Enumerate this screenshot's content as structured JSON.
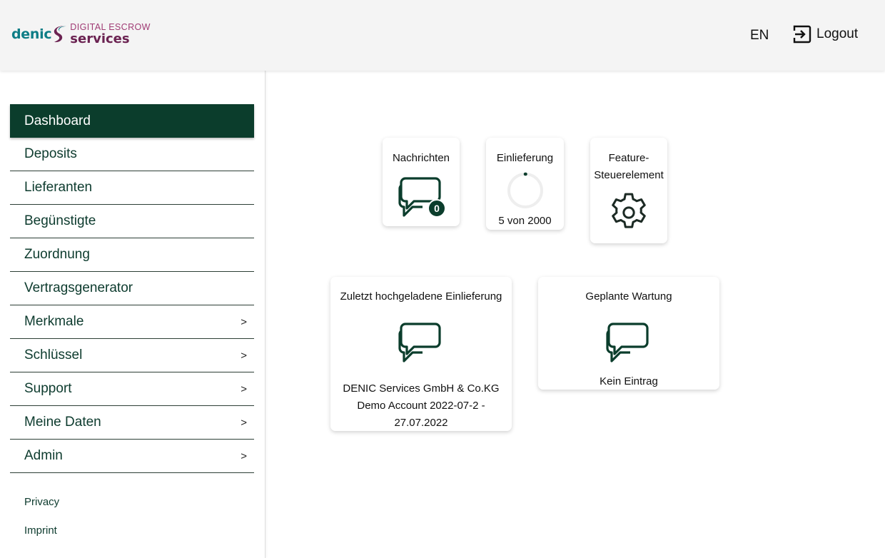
{
  "header": {
    "logo": {
      "brand": "denic",
      "top_line": "DIGITAL ESCROW",
      "bottom_line": "services"
    },
    "language": "EN",
    "logout_label": "Logout"
  },
  "sidebar": {
    "items": [
      {
        "label": "Dashboard",
        "active": true,
        "arrow": ""
      },
      {
        "label": "Deposits",
        "arrow": ""
      },
      {
        "label": "Lieferanten",
        "arrow": ""
      },
      {
        "label": "Begünstigte",
        "arrow": ""
      },
      {
        "label": "Zuordnung",
        "arrow": ""
      },
      {
        "label": "Vertragsgenerator",
        "arrow": ""
      },
      {
        "label": "Merkmale",
        "arrow": ">"
      },
      {
        "label": "Schlüssel",
        "arrow": ">"
      },
      {
        "label": "Support",
        "arrow": ">"
      },
      {
        "label": "Meine Daten",
        "arrow": ">"
      },
      {
        "label": "Admin",
        "arrow": ">"
      }
    ],
    "footer": {
      "privacy": "Privacy",
      "imprint": "Imprint"
    }
  },
  "cards": {
    "messages": {
      "title": "Nachrichten",
      "count": "0"
    },
    "delivery": {
      "title": "Einlieferung",
      "status": "5 von 2000",
      "progress_fraction": 0.0025
    },
    "feature": {
      "title_line1": "Feature-",
      "title_line2": "Steuerelement"
    },
    "last_upload": {
      "title": "Zuletzt hochgeladene Einlieferung",
      "line1": "DENIC Services GmbH & Co.KG",
      "line2": "Demo Account 2022-07-2 -",
      "line3": "27.07.2022"
    },
    "maintenance": {
      "title": "Geplante Wartung",
      "text": "Kein Eintrag"
    }
  },
  "colors": {
    "primary": "#0b3d2c",
    "brand_teal": "#0e7d86",
    "brand_purple": "#6b2352"
  }
}
